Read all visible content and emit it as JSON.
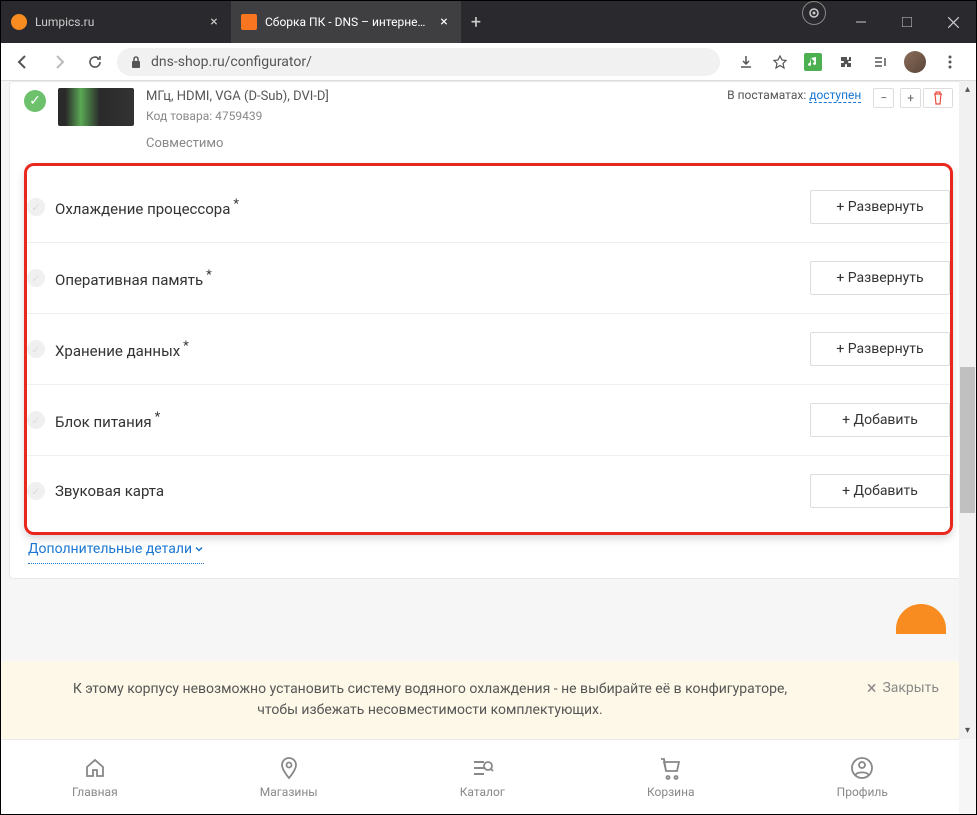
{
  "browser": {
    "tabs": [
      {
        "title": "Lumpics.ru",
        "favicon_color": "#f98c20"
      },
      {
        "title": "Сборка ПК - DNS – интернет ма",
        "favicon_color": "#f97520"
      }
    ],
    "url": "dns-shop.ru/configurator/"
  },
  "product": {
    "spec_tail": "МГц, HDMI, VGA (D-Sub), DVI-D]",
    "code_label": "Код товара:",
    "code_value": "4759439",
    "compat": "Совместимо",
    "avail_label": "В постаматах:",
    "avail_value": "доступен"
  },
  "categories": [
    {
      "name": "Охлаждение процессора",
      "required": true,
      "action": "+ Развернуть"
    },
    {
      "name": "Оперативная память",
      "required": true,
      "action": "+ Развернуть"
    },
    {
      "name": "Хранение данных",
      "required": true,
      "action": "+ Развернуть"
    },
    {
      "name": "Блок питания",
      "required": true,
      "action": "+ Добавить"
    },
    {
      "name": "Звуковая карта",
      "required": false,
      "action": "+ Добавить"
    }
  ],
  "more_link": "Дополнительные детали",
  "notice": {
    "text": "К этому корпусу невозможно установить систему водяного охлаждения - не выбирайте её в конфигураторе, чтобы избежать несовместимости комплектующих.",
    "close": "Закрыть"
  },
  "nav": [
    {
      "label": "Главная"
    },
    {
      "label": "Магазины"
    },
    {
      "label": "Каталог"
    },
    {
      "label": "Корзина"
    },
    {
      "label": "Профиль"
    }
  ]
}
